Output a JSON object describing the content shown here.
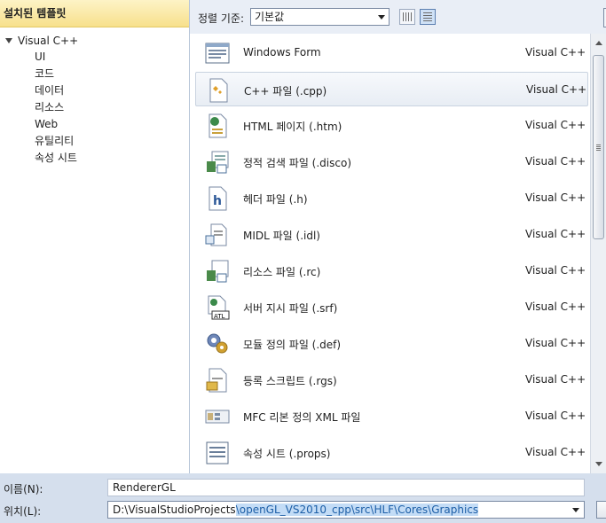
{
  "left_panel": {
    "header": "설치된 템플릿",
    "root": "Visual C++",
    "children": [
      "UI",
      "코드",
      "데이터",
      "리소스",
      "Web",
      "유틸리티",
      "속성 시트"
    ]
  },
  "sortbar": {
    "label": "정렬 기준:",
    "value": "기본값"
  },
  "items": [
    {
      "name": "Windows Form",
      "lang": "Visual C++",
      "icon": "form-icon"
    },
    {
      "name": "C++ 파일 (.cpp)",
      "lang": "Visual C++",
      "icon": "cpp-file-icon"
    },
    {
      "name": "HTML 페이지 (.htm)",
      "lang": "Visual C++",
      "icon": "html-page-icon"
    },
    {
      "name": "정적 검색 파일 (.disco)",
      "lang": "Visual C++",
      "icon": "disco-file-icon"
    },
    {
      "name": "헤더 파일 (.h)",
      "lang": "Visual C++",
      "icon": "header-file-icon"
    },
    {
      "name": "MIDL 파일 (.idl)",
      "lang": "Visual C++",
      "icon": "midl-file-icon"
    },
    {
      "name": "리소스 파일 (.rc)",
      "lang": "Visual C++",
      "icon": "resource-file-icon"
    },
    {
      "name": "서버 지시 파일 (.srf)",
      "lang": "Visual C++",
      "icon": "atl-srf-file-icon"
    },
    {
      "name": "모듈 정의 파일 (.def)",
      "lang": "Visual C++",
      "icon": "def-file-icon"
    },
    {
      "name": "등록 스크립트 (.rgs)",
      "lang": "Visual C++",
      "icon": "registry-script-icon"
    },
    {
      "name": "MFC 리본 정의 XML 파일",
      "lang": "Visual C++",
      "icon": "mfc-ribbon-icon"
    },
    {
      "name": "속성 시트 (.props)",
      "lang": "Visual C++",
      "icon": "property-sheet-icon"
    }
  ],
  "bottom": {
    "name_label": "이름(N):",
    "name_value": "RendererGL",
    "location_label": "위치(L):",
    "location_prefix": "D:\\VisualStudioProjects",
    "location_selected": "\\openGL_VS2010_cpp\\src\\HLF\\Cores\\Graphics"
  }
}
